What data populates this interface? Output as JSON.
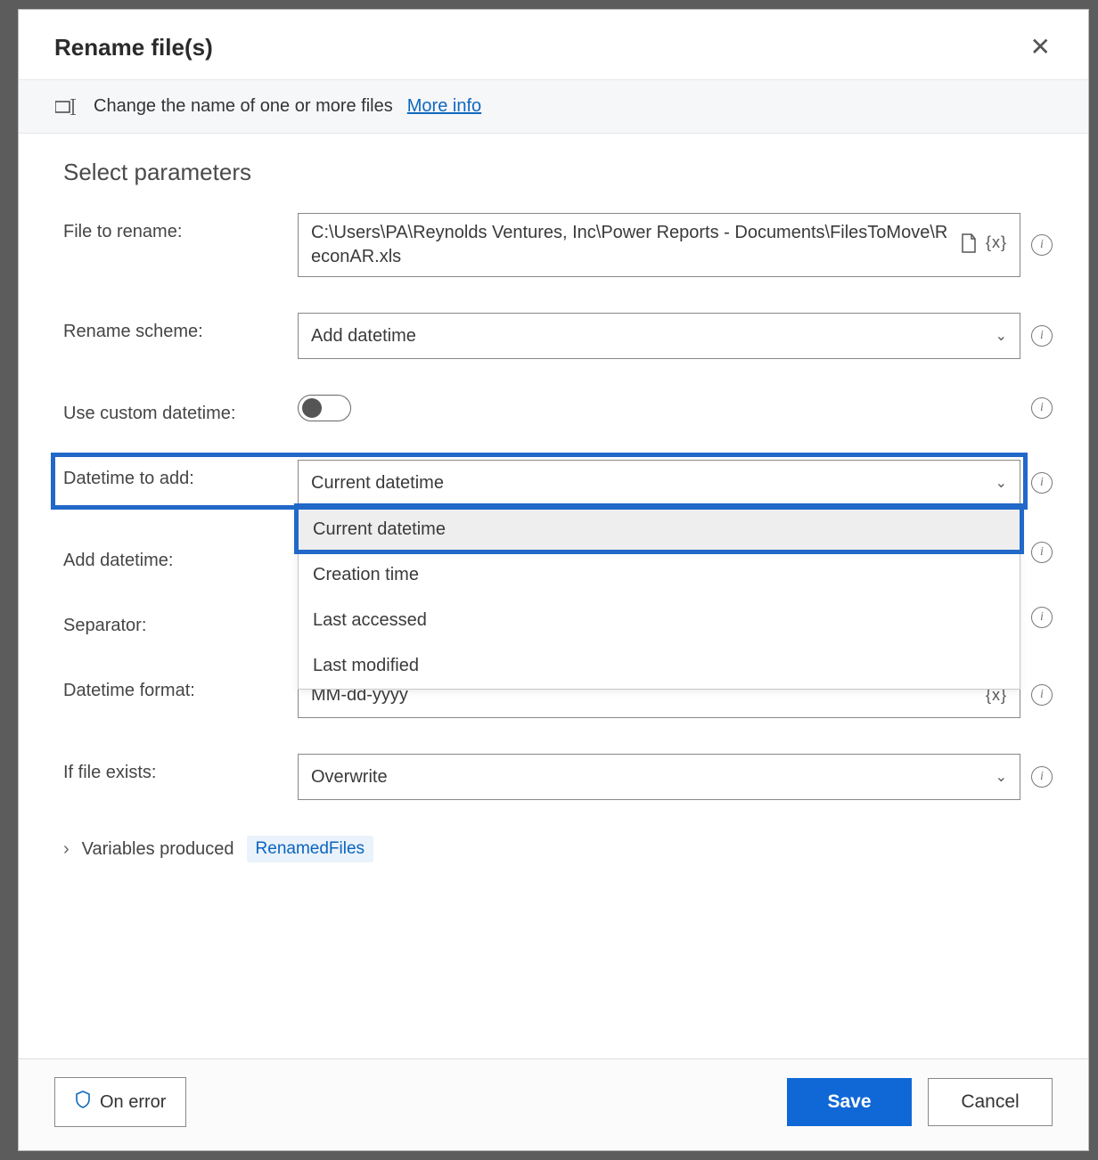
{
  "dialog": {
    "title": "Rename file(s)"
  },
  "info": {
    "text": "Change the name of one or more files",
    "more_info": "More info"
  },
  "section_title": "Select parameters",
  "fields": {
    "file_to_rename": {
      "label": "File to rename:",
      "value": "C:\\Users\\PA\\Reynolds Ventures, Inc\\Power Reports - Documents\\FilesToMove\\ReconAR.xls"
    },
    "rename_scheme": {
      "label": "Rename scheme:",
      "value": "Add datetime"
    },
    "use_custom_datetime": {
      "label": "Use custom datetime:",
      "value": false
    },
    "datetime_to_add": {
      "label": "Datetime to add:",
      "value": "Current datetime",
      "options": [
        "Current datetime",
        "Creation time",
        "Last accessed",
        "Last modified"
      ]
    },
    "add_datetime": {
      "label": "Add datetime:"
    },
    "separator": {
      "label": "Separator:"
    },
    "datetime_format": {
      "label": "Datetime format:",
      "value": "MM-dd-yyyy"
    },
    "if_file_exists": {
      "label": "If file exists:",
      "value": "Overwrite"
    }
  },
  "variables": {
    "label": "Variables produced",
    "pill": "RenamedFiles"
  },
  "footer": {
    "on_error": "On error",
    "save": "Save",
    "cancel": "Cancel"
  },
  "tokens": {
    "var_x": "{x}"
  }
}
